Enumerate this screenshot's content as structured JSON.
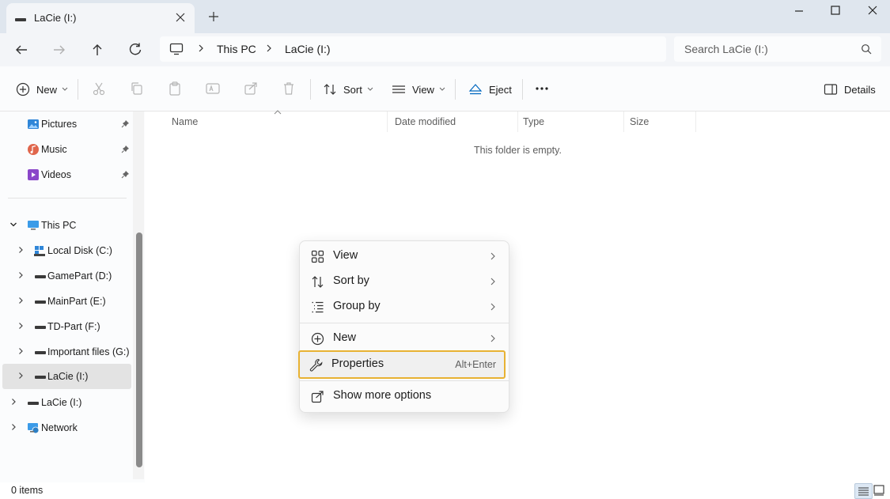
{
  "window": {
    "tab_title": "LaCie (I:)"
  },
  "address": {
    "crumbs": [
      "This PC",
      "LaCie (I:)"
    ],
    "search_placeholder": "Search LaCie (I:)"
  },
  "toolbar": {
    "new_label": "New",
    "sort_label": "Sort",
    "view_label": "View",
    "eject_label": "Eject",
    "details_label": "Details"
  },
  "nav": {
    "quick": [
      {
        "label": "Pictures",
        "icon": "pictures-icon"
      },
      {
        "label": "Music",
        "icon": "music-icon"
      },
      {
        "label": "Videos",
        "icon": "videos-icon"
      }
    ],
    "this_pc": "This PC",
    "drives": [
      "Local Disk (C:)",
      "GamePart (D:)",
      "MainPart (E:)",
      "TD-Part (F:)",
      "Important files (G:)",
      "LaCie (I:)"
    ],
    "lacie_root": "LaCie (I:)",
    "network": "Network"
  },
  "content": {
    "columns": [
      "Name",
      "Date modified",
      "Type",
      "Size"
    ],
    "empty_message": "This folder is empty."
  },
  "context_menu": {
    "items": [
      {
        "label": "View",
        "icon": "grid-icon"
      },
      {
        "label": "Sort by",
        "icon": "sort-icon"
      },
      {
        "label": "Group by",
        "icon": "group-icon"
      },
      {
        "label": "New",
        "icon": "plus-circle-icon"
      },
      {
        "label": "Properties",
        "icon": "wrench-icon",
        "shortcut": "Alt+Enter"
      },
      {
        "label": "Show more options",
        "icon": "share-icon"
      }
    ]
  },
  "status": {
    "item_count": "0 items"
  },
  "colors": {
    "titlebar": "#dfe6ee",
    "highlight_border": "#e8b233",
    "accent_blue": "#0067c0"
  }
}
